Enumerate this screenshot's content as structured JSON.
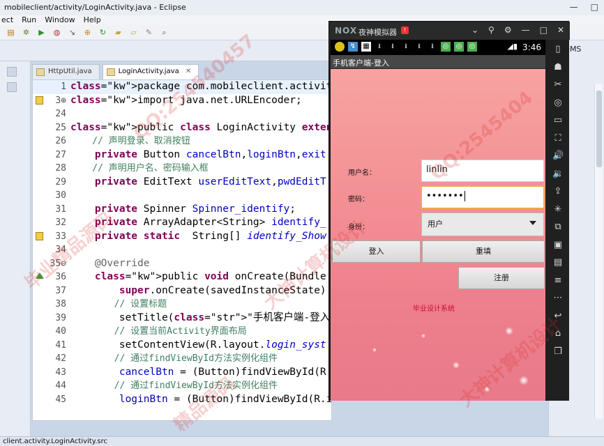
{
  "eclipse": {
    "window_title": "mobileclient/activity/LoginActivity.java - Eclipse",
    "menu": [
      "ect",
      "Run",
      "Window",
      "Help"
    ],
    "tabs": [
      {
        "label": "HttpUtil.java"
      },
      {
        "label": "LoginActivity.java",
        "close": "✕"
      }
    ],
    "right_label": "DDMS",
    "status": "client.activity.LoginActivity.src"
  },
  "code_lines": [
    {
      "num": "1",
      "text": "package com.mobileclient.activity;"
    },
    {
      "num": "3⊕",
      "text": "import java.net.URLEncoder;"
    },
    {
      "num": "24",
      "text": ""
    },
    {
      "num": "25",
      "text": "public class LoginActivity extends Activit"
    },
    {
      "num": "26",
      "text": "    // 声明登录、取消按钮"
    },
    {
      "num": "27",
      "text": "    private Button cancelBtn,loginBtn,exit"
    },
    {
      "num": "28",
      "text": "    // 声明用户名、密码输入框"
    },
    {
      "num": "29",
      "text": "    private EditText userEditText,pwdEditT"
    },
    {
      "num": "30",
      "text": ""
    },
    {
      "num": "31",
      "text": "    private Spinner Spinner_identify;"
    },
    {
      "num": "32",
      "text": "    private ArrayAdapter<String> identify_"
    },
    {
      "num": "33",
      "text": "    private static  String[] identify_Show"
    },
    {
      "num": "34",
      "text": ""
    },
    {
      "num": "35⊖",
      "text": "    @Override"
    },
    {
      "num": "36",
      "text": "    public void onCreate(Bundle savedInsta"
    },
    {
      "num": "37",
      "text": "        super.onCreate(savedInstanceState)"
    },
    {
      "num": "38",
      "text": "        // 设置标题"
    },
    {
      "num": "39",
      "text": "        setTitle(\"手机客户端-登入\");"
    },
    {
      "num": "40",
      "text": "        // 设置当前Activity界面布局"
    },
    {
      "num": "41",
      "text": "        setContentView(R.layout.login_syst"
    },
    {
      "num": "42",
      "text": "        // 通过findViewById方法实例化组件"
    },
    {
      "num": "43",
      "text": "        cancelBtn = (Button)findViewById(R"
    },
    {
      "num": "44",
      "text": "        // 通过findViewById方法实例化组件"
    },
    {
      "num": "45",
      "text": "        loginBtn = (Button)findViewById(R.id.loginButton);"
    }
  ],
  "emulator": {
    "name": "夜神模拟器",
    "badge": "!",
    "logo": "NOX",
    "time": "3:46",
    "window_ctrls": [
      "⌄",
      "⚲",
      "⚙",
      "—",
      "□",
      "✕"
    ],
    "app_title": "手机客户端-登入",
    "form": {
      "username_label": "用户名：",
      "username_value": "linlin",
      "password_label": "密码：",
      "password_value": "•••••••",
      "identity_label": "身份：",
      "identity_value": "用户",
      "login_button": "登入",
      "reset_button": "重填",
      "register_button": "注册",
      "footer": "毕业设计系统"
    },
    "side_icons": [
      "phone-icon",
      "robot-icon",
      "scissors-icon",
      "location-icon",
      "keyboard-icon",
      "fullscreen-icon",
      "volume-up-icon",
      "volume-down-icon",
      "apk-install-icon",
      "shake-icon",
      "screenshot-icon",
      "camera-icon",
      "folder-icon",
      "menu-icon",
      "more-icon",
      "back-icon",
      "home-icon",
      "recent-icon"
    ]
  },
  "watermarks": [
    "QQ:254540457",
    "大神计算机设计",
    "毕业精品源码",
    "QQ:2545404",
    "大神计算机设计",
    "精品源码"
  ]
}
